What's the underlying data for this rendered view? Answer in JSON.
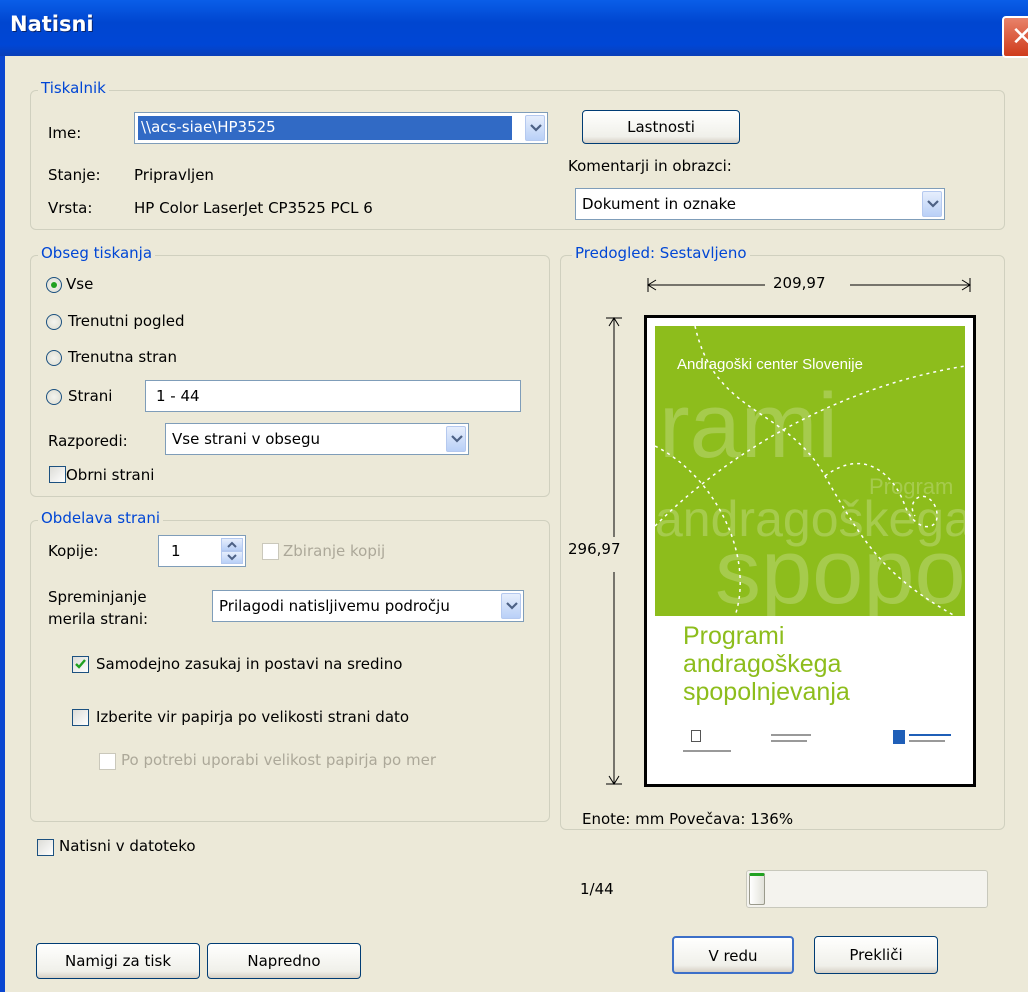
{
  "window": {
    "title": "Natisni",
    "close_glyph": "✕"
  },
  "printer": {
    "legend": "Tiskalnik",
    "name_label": "Ime:",
    "name_value": "\\\\acs-siae\\HP3525",
    "status_label": "Stanje:",
    "status_value": "Pripravljen",
    "type_label": "Vrsta:",
    "type_value": "HP Color LaserJet CP3525 PCL 6",
    "properties_button": "Lastnosti",
    "comments_label": "Komentarji in obrazci:",
    "comments_value": "Dokument in oznake"
  },
  "range": {
    "legend": "Obseg tiskanja",
    "options": [
      {
        "label": "Vse",
        "selected": true
      },
      {
        "label": "Trenutni pogled",
        "selected": false
      },
      {
        "label": "Trenutna stran",
        "selected": false
      },
      {
        "label": "Strani",
        "selected": false
      }
    ],
    "pages_value": "1 - 44",
    "subset_label": "Razporedi:",
    "subset_value": "Vse strani v obsegu",
    "reverse_label": "Obrni strani",
    "reverse_checked": false
  },
  "handling": {
    "legend": "Obdelava strani",
    "copies_label": "Kopije:",
    "copies_value": "1",
    "collate_label": "Zbiranje kopij",
    "scaling_label_line1": "Spreminjanje",
    "scaling_label_line2": "merila strani:",
    "scaling_value": "Prilagodi natisljivemu področju",
    "autorotate_label": "Samodejno zasukaj in postavi na sredino",
    "autorotate_checked": true,
    "paper_source_label": "Izberite vir papirja po velikosti strani dato",
    "paper_source_checked": false,
    "custom_paper_label": "Po potrebi uporabi velikost papirja po mer"
  },
  "print_to_file_label": "Natisni v datoteko",
  "preview": {
    "legend": "Predogled: Sestavljeno",
    "width_value": "209,97",
    "height_value": "296,97",
    "units_zoom": "Enote: mm Povečava: 136%",
    "page_indicator": "1/44",
    "slider_position": 0.0,
    "cover": {
      "org": "Andragoški center Slovenije",
      "bg_words": [
        "rami",
        "Program",
        "andragoškega",
        "spopo"
      ],
      "title_lines": [
        "Programi",
        "andragoškega",
        "spopolnjevanja"
      ],
      "green": "#8dbd1c"
    }
  },
  "buttons": {
    "tips": "Namigi za tisk",
    "advanced": "Napredno",
    "ok": "V redu",
    "cancel": "Prekliči"
  },
  "colors": {
    "accent": "#0046d5",
    "dialog_bg": "#ece9d8"
  }
}
